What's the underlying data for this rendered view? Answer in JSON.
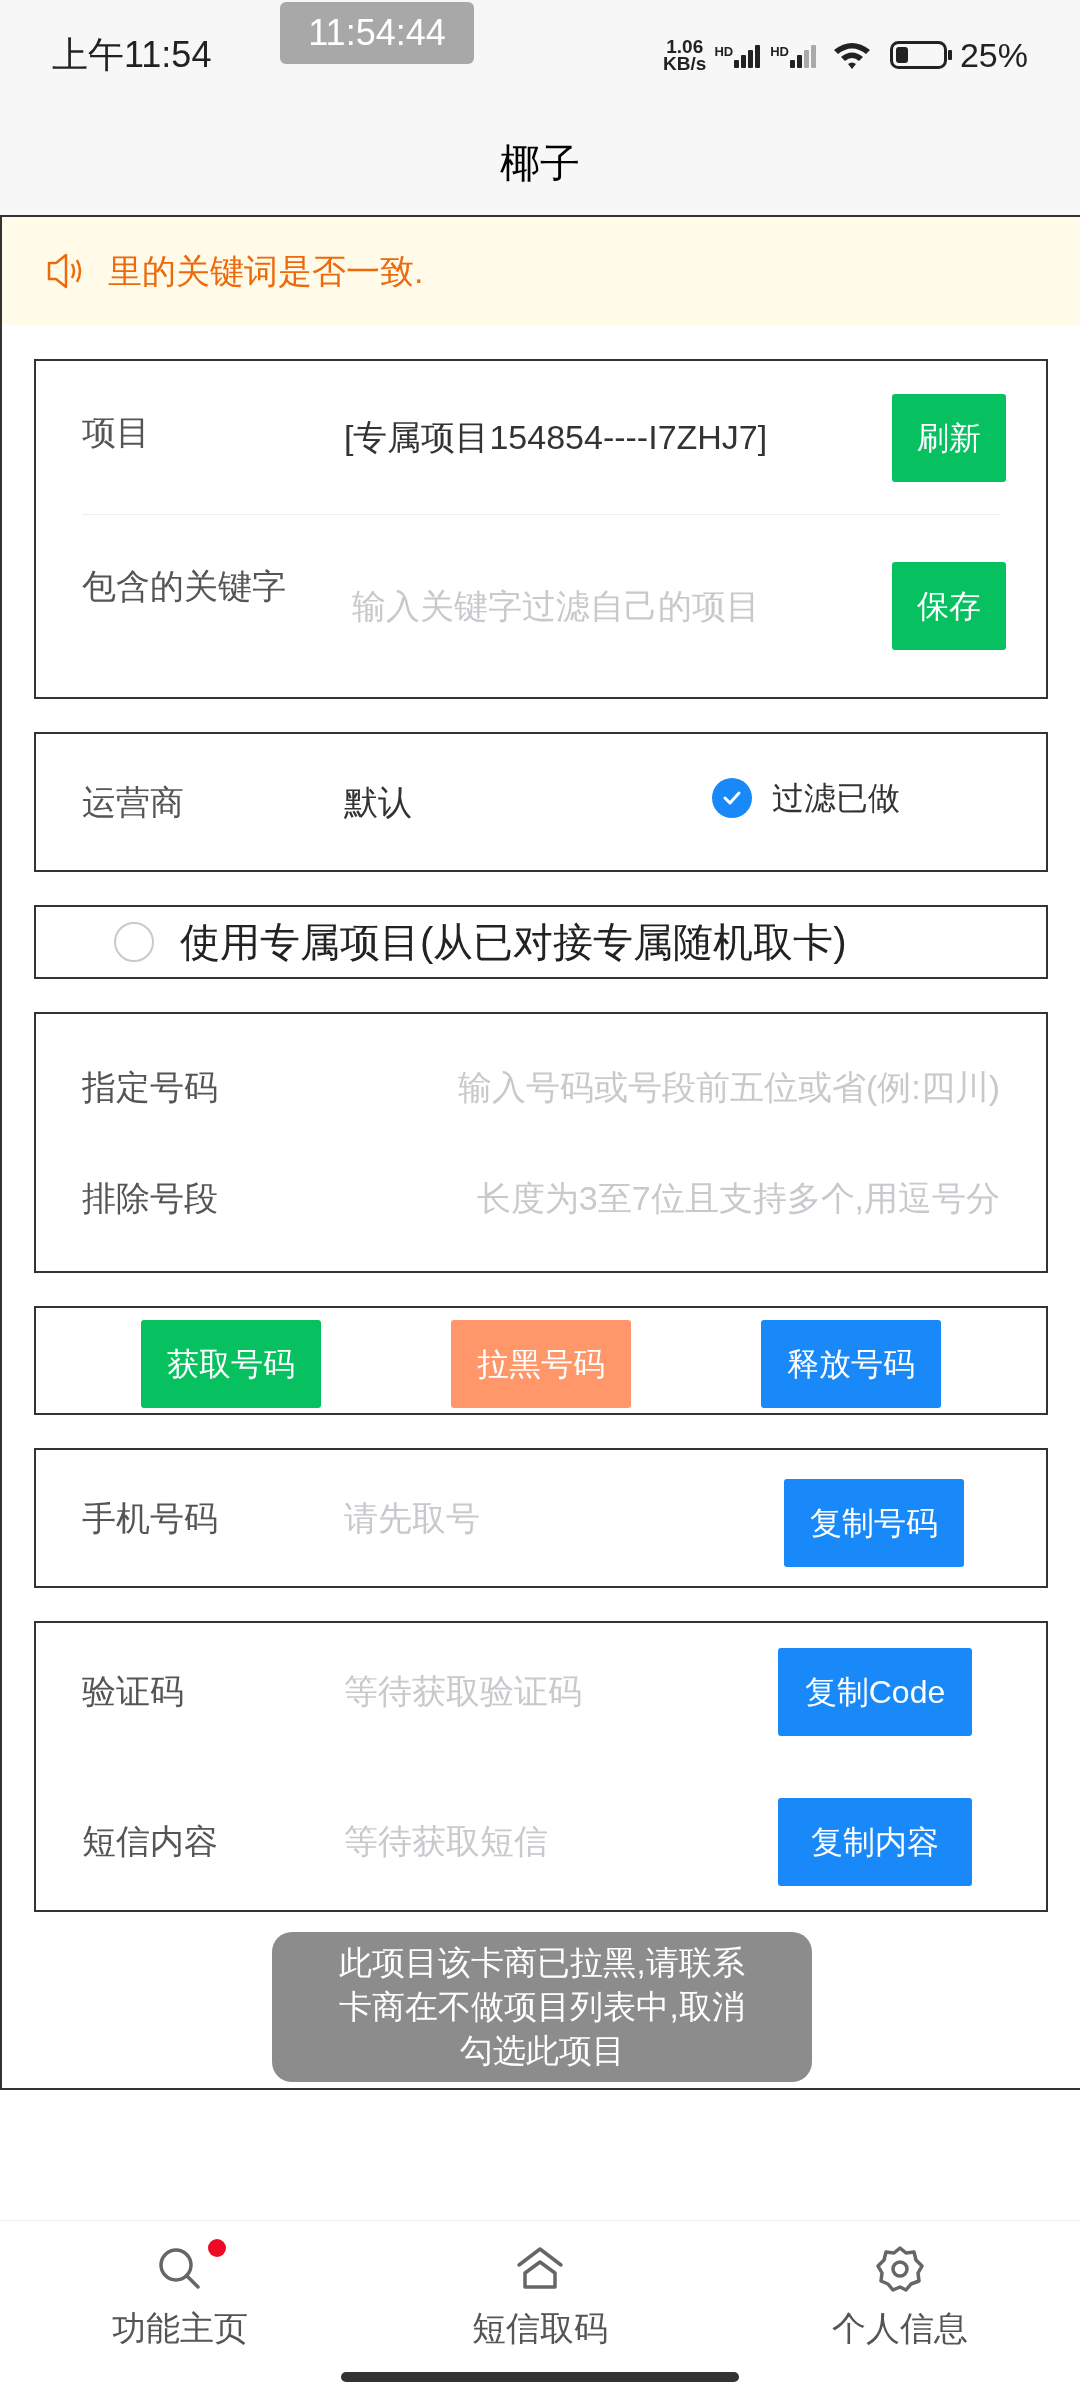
{
  "status_bar": {
    "time": "上午11:54",
    "clock_overlay": "11:54:44",
    "net_speed": [
      "1.06",
      "KB/s"
    ],
    "sim_labels": [
      "HD",
      "HD"
    ],
    "battery": "25%"
  },
  "title": "椰子",
  "notice": "里的关键词是否一致.",
  "project": {
    "label": "项目",
    "value": "[专属项目154854----I7ZHJ7]",
    "button": "刷新"
  },
  "keyword": {
    "label": "包含的关键字",
    "placeholder": "输入关键字过滤自己的项目",
    "button": "保存"
  },
  "operator": {
    "label": "运营商",
    "value": "默认",
    "filter": {
      "label": "过滤已做",
      "checked": true
    }
  },
  "exclusive": {
    "label": "使用专属项目(从已对接专属随机取卡)",
    "selected": false
  },
  "number_fields": [
    {
      "label": "指定号码",
      "placeholder": "输入号码或号段前五位或省(例:四川)"
    },
    {
      "label": "排除号段",
      "placeholder": "长度为3至7位且支持多个,用逗号分"
    }
  ],
  "actions": [
    {
      "label": "获取号码",
      "color": "#07c160"
    },
    {
      "label": "拉黑号码",
      "color": "#ff976a"
    },
    {
      "label": "释放号码",
      "color": "#1989fa"
    }
  ],
  "phone": {
    "label": "手机号码",
    "placeholder": "请先取号",
    "button": "复制号码"
  },
  "sms_rows": [
    {
      "label": "验证码",
      "placeholder": "等待获取验证码",
      "button": "复制Code"
    },
    {
      "label": "短信内容",
      "placeholder": "等待获取短信",
      "button": "复制内容"
    }
  ],
  "toast": "此项目该卡商已拉黑,请联系卡商在不做项目列表中,取消勾选此项目",
  "tabs": [
    {
      "label": "功能主页",
      "kind": "search",
      "dot": true
    },
    {
      "label": "短信取码",
      "kind": "home",
      "dot": false
    },
    {
      "label": "个人信息",
      "kind": "gear",
      "dot": false
    }
  ]
}
